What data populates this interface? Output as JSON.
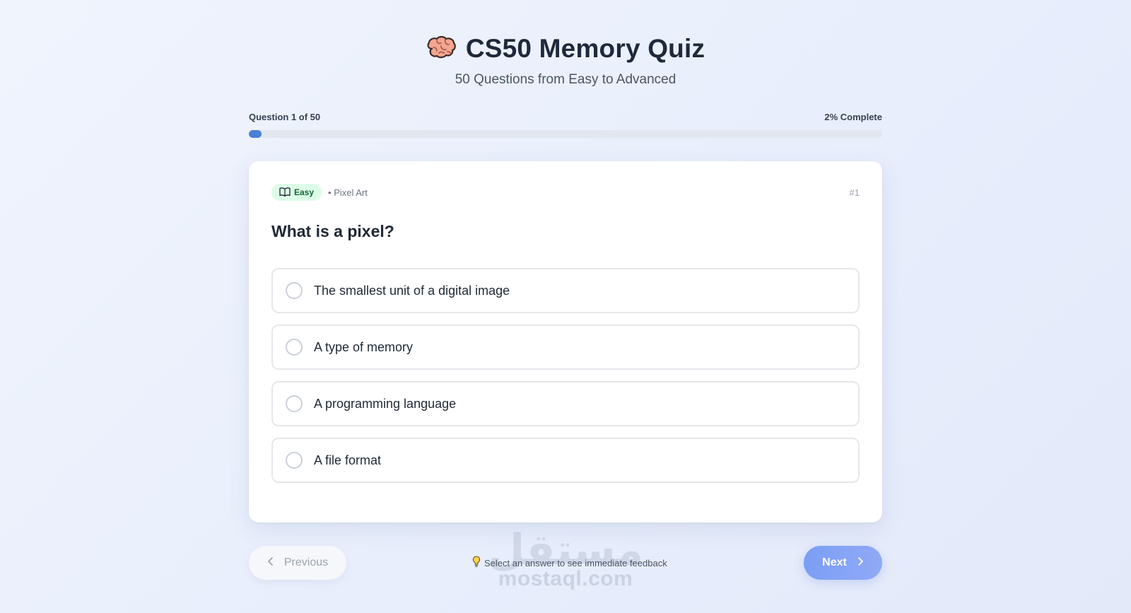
{
  "header": {
    "title": "CS50 Memory Quiz",
    "subtitle": "50 Questions from Easy to Advanced",
    "icon": "brain-icon"
  },
  "progress": {
    "label": "Question 1 of 50",
    "complete_label": "2% Complete",
    "percent": 2,
    "fill_color": "#4a7fd6"
  },
  "question": {
    "difficulty": "Easy",
    "difficulty_icon": "book-open-icon",
    "topic": "• Pixel Art",
    "number": "#1",
    "text": "What is a pixel?",
    "options": [
      "The smallest unit of a digital image",
      "A type of memory",
      "A programming language",
      "A file format"
    ]
  },
  "footer": {
    "previous_label": "Previous",
    "hint": "Select an answer to see immediate feedback",
    "hint_icon": "lightbulb-icon",
    "next_label": "Next"
  },
  "watermark": {
    "arabic": "مستقل",
    "latin": "mostaql.com"
  },
  "colors": {
    "accent": "#4a7fd6",
    "easy_badge_bg": "#dcfce7",
    "easy_badge_text": "#166534",
    "next_button": "#7b9ef5"
  }
}
